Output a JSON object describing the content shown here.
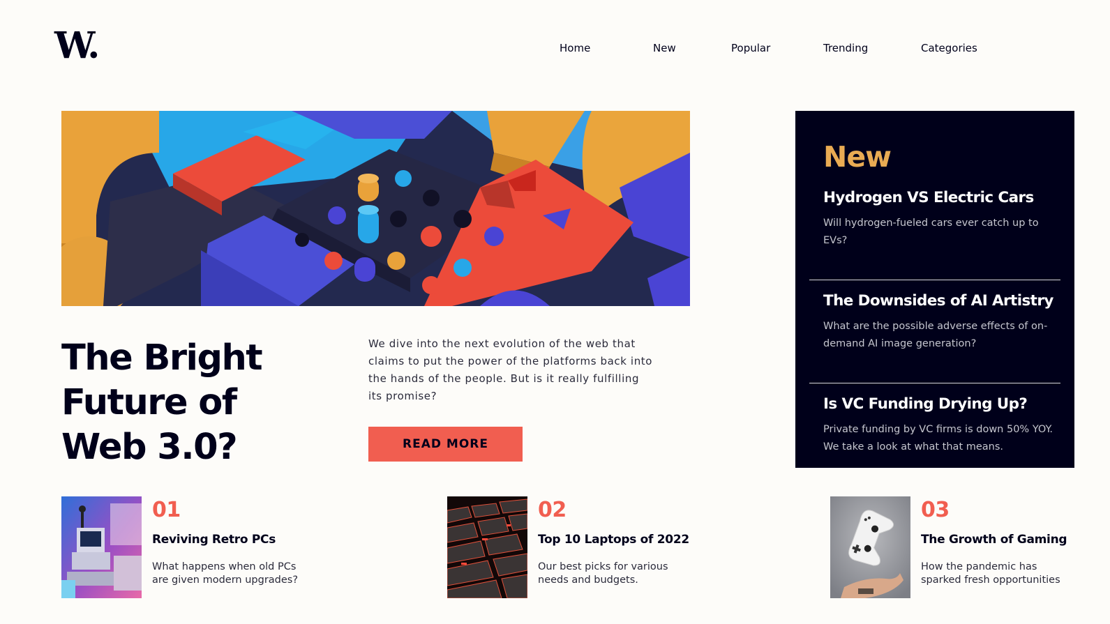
{
  "brand": {
    "logo": "W."
  },
  "nav": {
    "items": [
      "Home",
      "New",
      "Popular",
      "Trending",
      "Categories"
    ]
  },
  "hero": {
    "title": "The Bright Future of Web 3.0?",
    "description": "We dive into the next evolution of the web that claims to put the power of the platforms back into the hands of the people. But is it really fulfilling its promise?",
    "button_label": "READ MORE"
  },
  "new_panel": {
    "heading": "New",
    "items": [
      {
        "title": "Hydrogen VS Electric Cars",
        "description": "Will hydrogen-fueled cars ever catch up to EVs?"
      },
      {
        "title": "The Downsides of AI Artistry",
        "description": "What are the possible adverse effects of on-demand AI image generation?"
      },
      {
        "title": "Is VC Funding Drying Up?",
        "description": "Private funding by VC firms is down 50% YOY. We take a look at what that means."
      }
    ]
  },
  "cards": [
    {
      "number": "01",
      "title": "Reviving Retro PCs",
      "description": "What happens when old PCs are given modern upgrades?"
    },
    {
      "number": "02",
      "title": "Top 10 Laptops of 2022",
      "description": "Our best picks for various needs and budgets."
    },
    {
      "number": "03",
      "title": "The Growth of Gaming",
      "description": "How the pandemic has sparked fresh opportunities"
    }
  ],
  "colors": {
    "background": "#fdfcf9",
    "dark": "#00001a",
    "accent_red": "#f15e50",
    "accent_orange": "#e9ab53"
  }
}
